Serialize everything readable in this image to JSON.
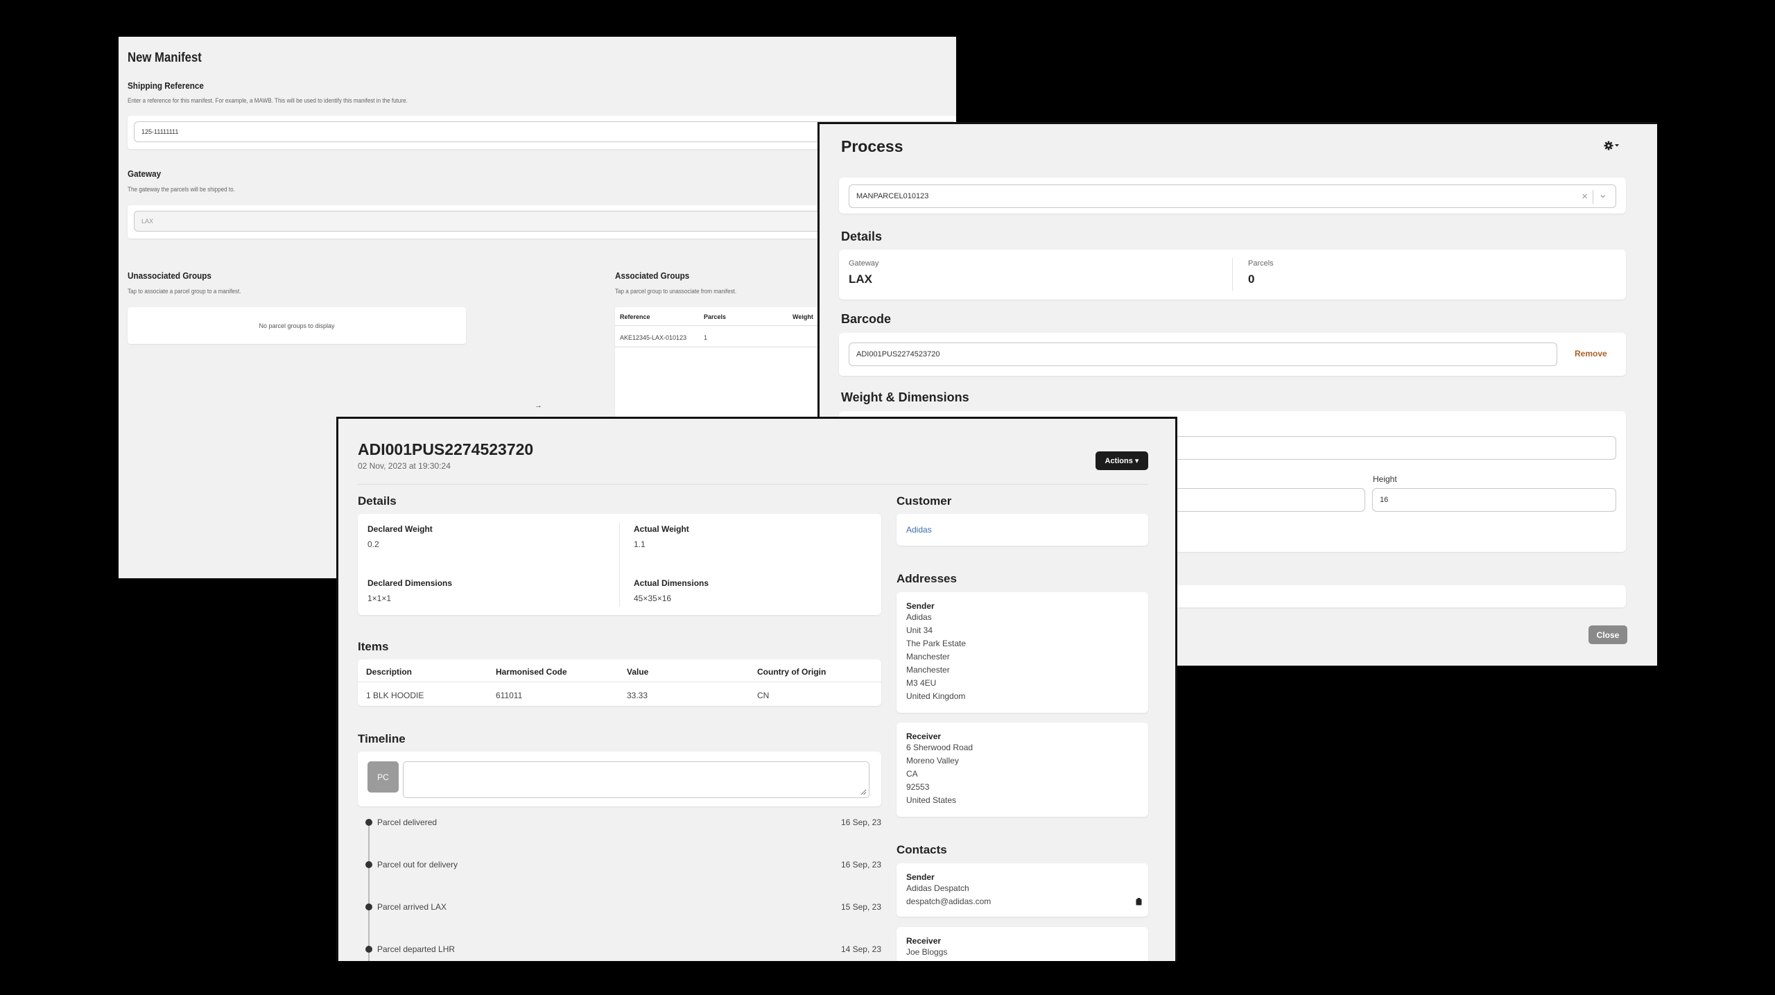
{
  "manifest": {
    "title": "New Manifest",
    "shipping_reference": {
      "heading": "Shipping Reference",
      "hint": "Enter a reference for this manifest. For example, a MAWB. This will be used to identify this manifest in the future.",
      "value": "125-11111111"
    },
    "gateway": {
      "heading": "Gateway",
      "hint": "The gateway the parcels will be shipped to.",
      "value": "LAX"
    },
    "unassociated": {
      "heading": "Unassociated Groups",
      "hint": "Tap to associate a parcel group to a manifest.",
      "empty": "No parcel groups to display"
    },
    "associated": {
      "heading": "Associated Groups",
      "hint": "Tap a parcel group to unassociate from manifest.",
      "columns": [
        "Reference",
        "Parcels",
        "Weight"
      ],
      "rows": [
        [
          "AKE12345-LAX-010123",
          "1",
          ""
        ]
      ]
    },
    "arrow": "→"
  },
  "process": {
    "title": "Process",
    "settings_icon": "gear-icon",
    "parcel_select": "MANPARCEL010123",
    "clear_glyph": "×",
    "chevron_glyph": "⌄",
    "details": {
      "heading": "Details",
      "gateway_label": "Gateway",
      "gateway_value": "LAX",
      "parcels_label": "Parcels",
      "parcels_value": "0"
    },
    "barcode": {
      "heading": "Barcode",
      "value": "ADI001PUS2274523720",
      "remove_label": "Remove"
    },
    "weight_dims": {
      "heading": "Weight & Dimensions",
      "height_label": "Height",
      "height_value": "16"
    },
    "close_label": "Close"
  },
  "parcel": {
    "barcode": "ADI001PUS2274523720",
    "timestamp": "02 Nov, 2023 at 19:30:24",
    "actions_label": "Actions ▾",
    "details": {
      "heading": "Details",
      "declared_weight_label": "Declared Weight",
      "declared_weight": "0.2",
      "actual_weight_label": "Actual Weight",
      "actual_weight": "1.1",
      "declared_dims_label": "Declared Dimensions",
      "declared_dims": "1×1×1",
      "actual_dims_label": "Actual Dimensions",
      "actual_dims": "45×35×16"
    },
    "items": {
      "heading": "Items",
      "columns": [
        "Description",
        "Harmonised Code",
        "Value",
        "Country of Origin"
      ],
      "rows": [
        [
          "1 BLK HOODIE",
          "611011",
          "33.33",
          "CN"
        ]
      ]
    },
    "timeline": {
      "heading": "Timeline",
      "avatar": "PC",
      "events": [
        {
          "text": "Parcel delivered",
          "date": "16 Sep, 23"
        },
        {
          "text": "Parcel out for delivery",
          "date": "16 Sep, 23"
        },
        {
          "text": "Parcel arrived LAX",
          "date": "15 Sep, 23"
        },
        {
          "text": "Parcel departed LHR",
          "date": "14 Sep, 23"
        }
      ]
    },
    "customer": {
      "heading": "Customer",
      "name": "Adidas"
    },
    "addresses": {
      "heading": "Addresses",
      "sender_label": "Sender",
      "sender": [
        "Adidas",
        "Unit 34",
        "The Park Estate",
        "Manchester",
        "Manchester",
        "M3 4EU",
        "United Kingdom"
      ],
      "receiver_label": "Receiver",
      "receiver": [
        "6 Sherwood Road",
        "Moreno Valley",
        "CA",
        "92553",
        "United States"
      ]
    },
    "contacts": {
      "heading": "Contacts",
      "sender_label": "Sender",
      "sender_name": "Adidas Despatch",
      "sender_email": "despatch@adidas.com",
      "receiver_label": "Receiver",
      "receiver_name": "Joe Bloggs"
    }
  }
}
